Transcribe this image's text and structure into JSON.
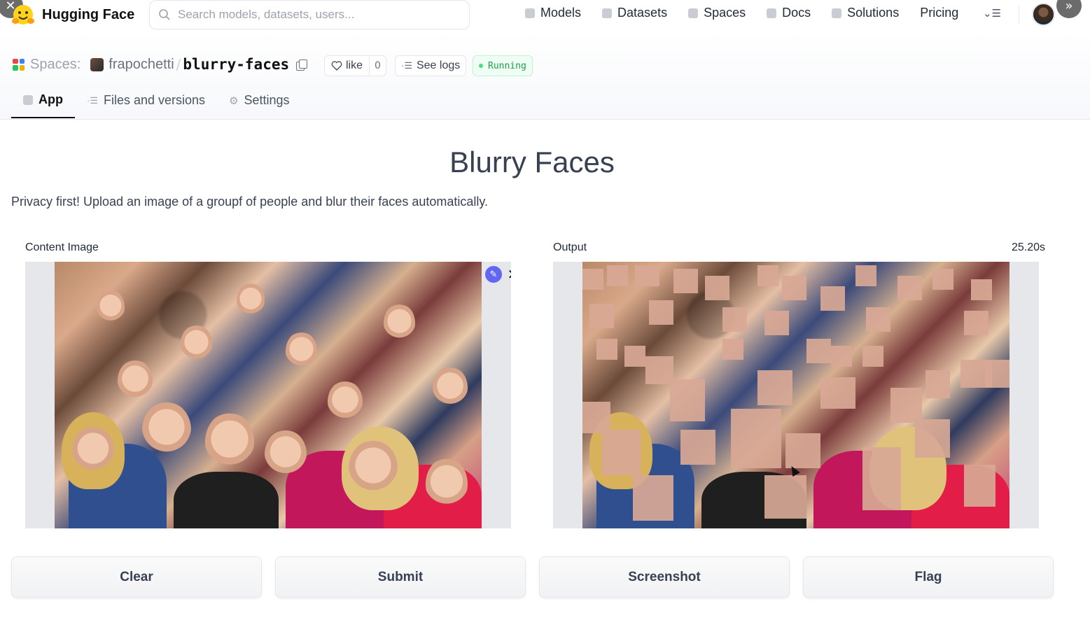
{
  "nav": {
    "brand": "Hugging Face",
    "search_placeholder": "Search models, datasets, users...",
    "links": [
      "Models",
      "Datasets",
      "Spaces",
      "Docs",
      "Solutions",
      "Pricing"
    ]
  },
  "space": {
    "section": "Spaces:",
    "owner": "frapochetti",
    "separator": "/",
    "repo": "blurry-faces",
    "like_label": "like",
    "like_count": "0",
    "logs_label": "See logs",
    "status": "Running",
    "tabs": [
      "App",
      "Files and versions",
      "Settings"
    ]
  },
  "app": {
    "title": "Blurry Faces",
    "description": "Privacy first! Upload an image of a groupf of people and blur their faces automatically.",
    "input_label": "Content Image",
    "output_label": "Output",
    "output_time": "25.20s",
    "buttons": {
      "clear": "Clear",
      "submit": "Submit",
      "screenshot": "Screenshot",
      "flag": "Flag"
    }
  },
  "colors": {
    "accent_edit": "#6366f1",
    "status_green": "#16a34a"
  },
  "icons": {
    "edit": "pencil-icon",
    "remove": "close-icon",
    "search": "search-icon",
    "like": "heart-icon",
    "copy": "copy-icon"
  }
}
